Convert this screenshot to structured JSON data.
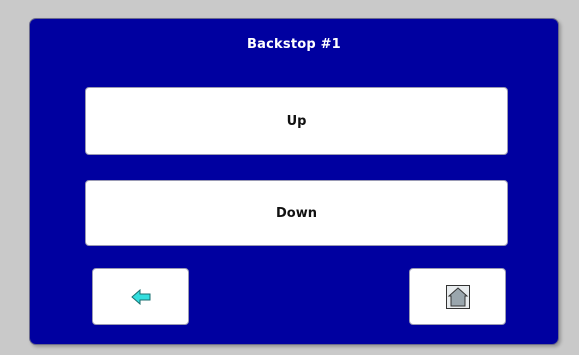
{
  "screen": {
    "title": "Backstop #1"
  },
  "buttons": {
    "up_label": "Up",
    "down_label": "Down"
  },
  "nav": {
    "back_icon": "arrow-left-icon",
    "home_icon": "home-icon"
  },
  "colors": {
    "panel_background": "#0000a0",
    "outer_background": "#c9c9c9",
    "button_background": "#ffffff",
    "back_arrow_fill": "#33dede",
    "home_icon_fill": "#9aa6ad"
  }
}
